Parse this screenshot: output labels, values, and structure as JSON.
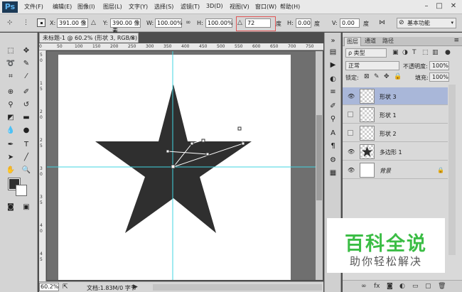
{
  "app": {
    "logo": "Ps"
  },
  "menu": [
    "文件(F)",
    "编辑(E)",
    "图像(I)",
    "图层(L)",
    "文字(Y)",
    "选择(S)",
    "滤镜(T)",
    "3D(D)",
    "视图(V)",
    "窗口(W)",
    "帮助(H)"
  ],
  "window_controls": {
    "minimize": "–",
    "restore": "□",
    "close": "✕"
  },
  "options": {
    "x_label": "X:",
    "x_value": "391.00 像",
    "y_label": "Y:",
    "y_value": "390.00 像素",
    "w_label": "W:",
    "w_value": "100.00%",
    "link_icon": "∞",
    "h_label": "H:",
    "h_value": "100.00%",
    "rotate_icon": "△",
    "angle_value": "72",
    "hskew_label": "H:",
    "hskew_value": "0.00",
    "hskew_unit": "度",
    "vskew_label": "V:",
    "vskew_value": "0.00",
    "vskew_unit": "度",
    "angle_unit": "度",
    "workspace": "基本功能",
    "cancel_icon": "⊘",
    "commit_icon": "✓"
  },
  "document": {
    "tab_title": "未标题-1 @ 60.2% (形状 3, RGB/8) *",
    "tab_close": "×",
    "zoom": "60.2%",
    "info": "文档:1.83M/0 字节",
    "status_arrow": "▶",
    "ruler_top": [
      "0",
      "50",
      "100",
      "150",
      "200",
      "250",
      "300",
      "350",
      "400",
      "450",
      "500",
      "550",
      "600",
      "650",
      "700",
      "750"
    ],
    "ruler_left": [
      "5",
      "0",
      "1",
      "5",
      "2",
      "0",
      "2",
      "5",
      "3",
      "0",
      "3",
      "5",
      "4",
      "0",
      "4",
      "5"
    ]
  },
  "layers_panel": {
    "tabs": [
      "图层",
      "通道",
      "路径"
    ],
    "filter_label": "ρ 类型",
    "blend_mode": "正常",
    "opacity_label": "不透明度:",
    "opacity_value": "100%",
    "lock_label": "锁定:",
    "fill_label": "填充:",
    "fill_value": "100%",
    "layers": [
      {
        "name": "形状 3",
        "visible": true,
        "selected": true
      },
      {
        "name": "形状 1",
        "visible": false,
        "selected": false
      },
      {
        "name": "形状 2",
        "visible": false,
        "selected": false
      },
      {
        "name": "多边形 1",
        "visible": true,
        "selected": false
      },
      {
        "name": "背景",
        "visible": true,
        "selected": false,
        "locked": true
      }
    ]
  },
  "watermark": {
    "title": "百科全说",
    "subtitle": "助你轻松解决"
  },
  "colors": {
    "foreground": "#2f2f2f",
    "background": "#ffffff",
    "guide": "#41d4e0",
    "accent_green": "#3bbd45"
  }
}
